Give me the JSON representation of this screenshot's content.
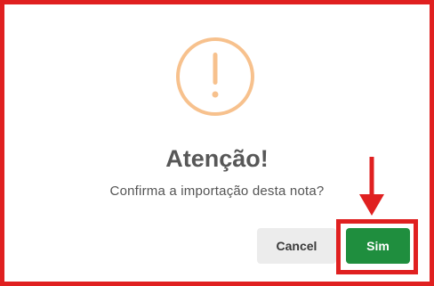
{
  "dialog": {
    "icon": "exclamation-circle-icon",
    "title": "Atenção!",
    "message": "Confirma a importação desta nota?",
    "cancel_label": "Cancel",
    "confirm_label": "Sim"
  },
  "annotation": {
    "frame_color": "#e02020",
    "arrow_icon": "down-arrow-icon",
    "highlight_target": "Sim"
  },
  "colors": {
    "warning": "#f7c18d",
    "confirm": "#1f8e3e",
    "cancel_bg": "#ececec",
    "title_text": "#575757"
  }
}
